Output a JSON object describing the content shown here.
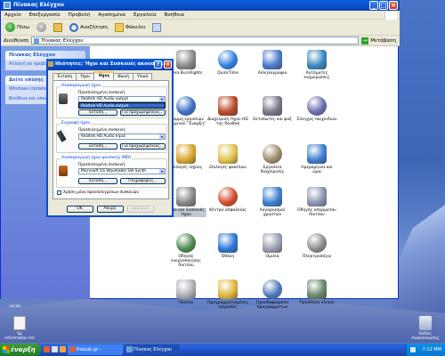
{
  "window": {
    "title": "Πίνακας Ελέγχου",
    "menu": [
      "Αρχείο",
      "Επεξεργασία",
      "Προβολή",
      "Αγαπημένα",
      "Εργαλεία",
      "Βοήθεια"
    ],
    "toolbar": {
      "back": "Πίσω",
      "search": "Αναζήτηση",
      "folders": "Φάκελοι"
    },
    "address_label": "Διεύθυνση",
    "address_value": "Πίνακας Ελέγχου",
    "go_label": "Μετάβαση"
  },
  "taskpane": {
    "panel1_title": "Πίνακας Ελέγχου",
    "panel1_link": "Αλλαγή σε προβολή",
    "panel2_title": "Δείτε επίσης",
    "panel2_links": [
      "Windows Update",
      "Βοήθεια και υποστήριξη"
    ]
  },
  "icons": [
    {
      "label": "Nero BurnRights",
      "color": "#8b8b8b"
    },
    {
      "label": "QuickTime",
      "color": "#2d7fe0"
    },
    {
      "label": "Αλληλογραφία",
      "color": "#4a7ad0"
    },
    {
      "label": "Αυτόματες ενημερώσεις",
      "color": "#3a8ac0"
    },
    {
      "label": "Γραμμή εργασιών και μενού \"Έναρξη\"",
      "color": "#3c6ec8"
    },
    {
      "label": "Διαχείριση Ήχου HD της Realtek",
      "color": "#b84a2a"
    },
    {
      "label": "Εκτυπωτές και φαξ",
      "color": "#7a7a8a"
    },
    {
      "label": "Έλεγχος παιχνιδιών",
      "color": "#6a6ab0"
    },
    {
      "label": "Επιλογές ισχύος",
      "color": "#d8a830"
    },
    {
      "label": "Επιλογές φακέλων",
      "color": "#e2c24a"
    },
    {
      "label": "Εργαλεία διαχείρισης",
      "color": "#9a8a6a"
    },
    {
      "label": "Ημερομηνία και ώρα",
      "color": "#3d7ed0"
    },
    {
      "label": "Ήχοι και Συσκευές Ήχου",
      "color": "#888888"
    },
    {
      "label": "Κέντρο ασφαλείας",
      "color": "#d24a2a"
    },
    {
      "label": "Λογαριασμοί χρηστών",
      "color": "#3f7fcf"
    },
    {
      "label": "Οδηγός ασύρματου δικτύου",
      "color": "#8a96b0"
    },
    {
      "label": "Οδηγός ενεργοποίησης δικτύου",
      "color": "#4a8a4a"
    },
    {
      "label": "Οθόνη",
      "color": "#2f78d8"
    },
    {
      "label": "Ομιλία",
      "color": "#9aa0b0"
    },
    {
      "label": "Πληκτρολόγιο",
      "color": "#8a8a8a"
    },
    {
      "label": "Ποντίκι",
      "color": "#b0b0b8"
    },
    {
      "label": "Προγραμματισμένες εργασίες",
      "color": "#e0b840"
    },
    {
      "label": "Προσθαφαίρεση προγραμμάτων",
      "color": "#4a7ab8"
    },
    {
      "label": "Προσθήκη υλικού",
      "color": "#6a8a6a"
    }
  ],
  "dialog": {
    "title": "Ιδιότητες: Ήχοι και Συσκευές ακουστικής",
    "tabs": [
      "Ένταση",
      "Ήχοι",
      "Ήχος",
      "Φωνή",
      "Υλικό"
    ],
    "active_tab": "Ήχος",
    "playback": {
      "group": "Αναπαραγωγή ήχου",
      "label": "Προεπιλεγμένη συσκευή:",
      "value": "Realtek HD Audio output",
      "dropdown_item": "Realtek HD Audio output",
      "volume_btn": "Ένταση...",
      "advanced_btn": "Για προχωρημένους..."
    },
    "recording": {
      "group": "Εγγραφή ήχου",
      "label": "Προεπιλεγμένη συσκευή:",
      "value": "Realtek HD Audio Input",
      "volume_btn": "Ένταση...",
      "advanced_btn": "Για προχωρημένους..."
    },
    "midi": {
      "group": "Αναπαραγωγή ήχου μουσικής MIDI",
      "label": "Προεπιλεγμένη συσκευή:",
      "value": "Microsoft GS Wavetable SW Synth",
      "volume_btn": "Ένταση...",
      "about_btn": "Πληροφορίες..."
    },
    "checkbox": "Χρήση μόνο προεπιλεγμένων συσκευών",
    "ok": "ΟΚ",
    "cancel": "Άκυρο",
    "apply": "Εφαρμογή"
  },
  "desktop": {
    "left_icon": "Sp information.txt",
    "right_icon": "Κάδος Ανακύκλωσης",
    "top_label": "cacao"
  },
  "taskbar": {
    "start": "έναρξη",
    "tasks": [
      "theLab.gr - Αντιστοιχ...",
      "Πίνακας Ελέγχου"
    ],
    "clock": "7:12 ΜΜ"
  }
}
